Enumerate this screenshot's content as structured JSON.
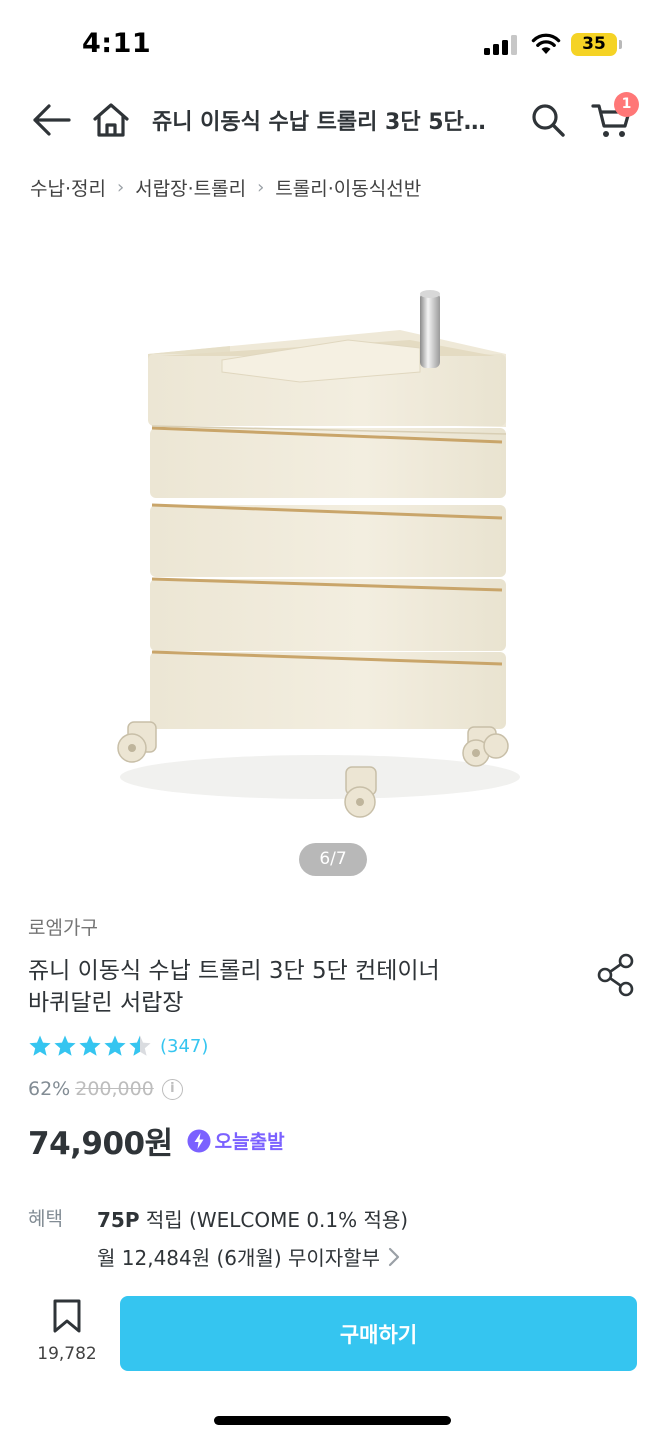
{
  "status_bar": {
    "time": "4:11",
    "battery": "35"
  },
  "header": {
    "title": "쥬니 이동식 수납 트롤리 3단 5단…",
    "cart_count": "1",
    "icons": [
      "back-arrow-icon",
      "home-icon",
      "search-icon",
      "cart-icon"
    ]
  },
  "breadcrumb": [
    "수납·정리",
    "서랍장·트롤리",
    "트롤리·이동식선반"
  ],
  "gallery": {
    "counter": "6/7"
  },
  "product": {
    "brand": "로엠가구",
    "name_line1": "쥬니 이동식 수납 트롤리 3단 5단 컨테이너",
    "name_line2": "바퀴달린 서랍장",
    "rating": 4.5,
    "review_count": "(347)",
    "discount": "62%",
    "original_price": "200,000",
    "price": "74,900원",
    "delivery_badge": "오늘출발"
  },
  "benefit": {
    "label": "혜택",
    "points": "75P",
    "points_text": " 적립 (WELCOME 0.1% 적용)",
    "installment": "월 12,484원 (6개월) 무이자할부"
  },
  "bottom_bar": {
    "scrap_count": "19,782",
    "buy_label": "구매하기"
  },
  "colors": {
    "accent": "#35c5f0",
    "badge": "#ff7777",
    "today_purple": "#7b61ff"
  }
}
